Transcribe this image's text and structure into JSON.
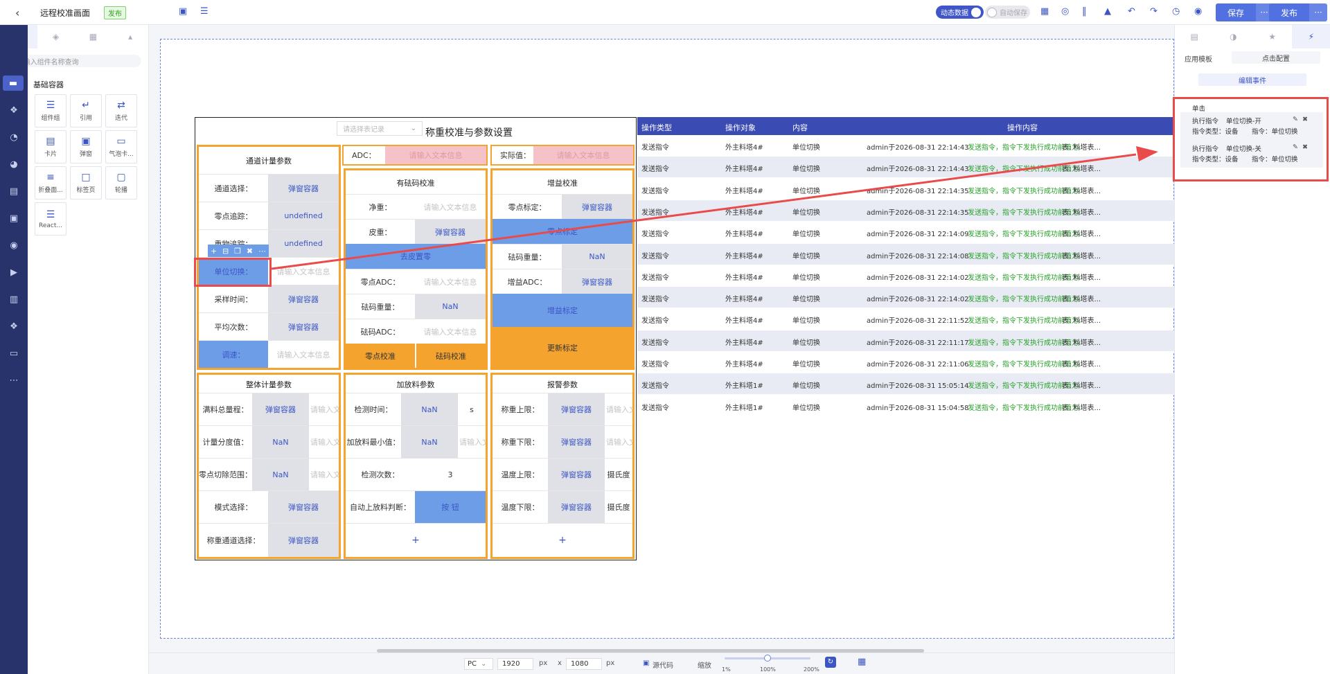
{
  "header": {
    "title": "远程校准画面",
    "tag": "发布",
    "toggle_dynamic": "动态数据",
    "toggle_autosave": "自动保存",
    "save": "保存",
    "more": "···",
    "publish": "发布"
  },
  "left_panel": {
    "search_placeholder": "请输入组件名称查询",
    "category": "基础容器",
    "components": [
      "组件组",
      "引用",
      "迭代",
      "卡片",
      "弹窗",
      "气泡卡...",
      "折叠面...",
      "标签页",
      "轮播",
      "React..."
    ]
  },
  "panel": {
    "selector_placeholder": "请选择表记录",
    "title": "称重校准与参数设置",
    "adc_label": "ADC：",
    "adc_placeholder": "请输入文本信息",
    "actual_label": "实际值：",
    "actual_placeholder": "请输入文本信息",
    "channel": {
      "heading": "通道计量参数",
      "rows": [
        {
          "label": "通道选择：",
          "value": "弹窗容器"
        },
        {
          "label": "零点追踪：",
          "value": "undefined"
        },
        {
          "label": "重物追踪：",
          "value": "undefined"
        },
        {
          "label": "单位切换：",
          "value": "请输入文本信息"
        },
        {
          "label": "采样时间：",
          "value": "弹窗容器"
        },
        {
          "label": "平均次数：",
          "value": "弹窗容器"
        },
        {
          "label": "调速：",
          "value": "请输入文本信息"
        }
      ]
    },
    "weight_cal": {
      "heading": "有砝码校准",
      "net_label": "净重：",
      "net_ph": "请输入文本信息",
      "tare_label": "皮重：",
      "tare_value": "弹窗容器",
      "tare_btn": "去皮置零",
      "zero_adc_label": "零点ADC：",
      "zero_adc_ph": "请输入文本信息",
      "weight_label": "砝码重量：",
      "weight_value": "NaN",
      "weight_adc_label": "砝码ADC：",
      "weight_adc_ph": "请输入文本信息",
      "btn_zero": "零点校准",
      "btn_weight": "砝码校准"
    },
    "gain_cal": {
      "heading": "增益校准",
      "zero_set_label": "零点标定：",
      "zero_set_value": "弹窗容器",
      "zero_btn": "零点标定",
      "weight_label": "砝码重量：",
      "weight_value": "NaN",
      "gain_adc_label": "增益ADC：",
      "gain_adc_value": "弹窗容器",
      "gain_btn": "增益标定",
      "update_btn": "更新标定"
    },
    "overall": {
      "heading": "整体计量参数",
      "rows": [
        {
          "label": "满料总量程：",
          "value": "弹窗容器",
          "ph": "请输入文本信息"
        },
        {
          "label": "计量分度值：",
          "value": "NaN",
          "ph": "请输入文本信息"
        },
        {
          "label": "零点切除范围：",
          "value": "NaN",
          "ph": "请输入文本信息"
        },
        {
          "label": "模式选择：",
          "value": "弹窗容器"
        },
        {
          "label": "称重通道选择：",
          "value": "弹窗容器"
        }
      ]
    },
    "feeding": {
      "heading": "加放料参数",
      "detect_time_label": "检测时间：",
      "detect_time_value": "NaN",
      "detect_time_unit": "s",
      "min_label": "加放料最小值：",
      "min_value": "NaN",
      "min_ph": "请输入文本信息",
      "count_label": "检测次数：",
      "count_value": "3",
      "auto_label": "自动上放料判断：",
      "auto_btn": "按 钮"
    },
    "alarm": {
      "heading": "报警参数",
      "rows": [
        {
          "label": "称重上限：",
          "value": "弹窗容器",
          "extra": "请输入文本信息"
        },
        {
          "label": "称重下限：",
          "value": "弹窗容器",
          "extra": "请输入文本信息"
        },
        {
          "label": "温度上限：",
          "value": "弹窗容器",
          "extra": "摄氏度"
        },
        {
          "label": "温度下限：",
          "value": "弹窗容器",
          "extra": "摄氏度"
        }
      ]
    }
  },
  "table": {
    "headers": [
      "操作类型",
      "操作对象",
      "内容",
      "操作内容"
    ],
    "rows": [
      {
        "type": "发送指令",
        "target": "外主料塔4#",
        "content": "单位切换",
        "prefix": "admin于2026-08-31 22:14:43",
        "msg": "发送指令，指令下发执行成功前值为:",
        "tail": "表: 料塔表..."
      },
      {
        "type": "发送指令",
        "target": "外主料塔4#",
        "content": "单位切换",
        "prefix": "admin于2026-08-31 22:14:43",
        "msg": "发送指令，指令下发执行成功前值为:",
        "tail": "表: 料塔表..."
      },
      {
        "type": "发送指令",
        "target": "外主料塔4#",
        "content": "单位切换",
        "prefix": "admin于2026-08-31 22:14:35",
        "msg": "发送指令，指令下发执行成功前值为:",
        "tail": "表: 料塔表..."
      },
      {
        "type": "发送指令",
        "target": "外主料塔4#",
        "content": "单位切换",
        "prefix": "admin于2026-08-31 22:14:35",
        "msg": "发送指令，指令下发执行成功前值为:",
        "tail": "表: 料塔表..."
      },
      {
        "type": "发送指令",
        "target": "外主料塔4#",
        "content": "单位切换",
        "prefix": "admin于2026-08-31 22:14:09",
        "msg": "发送指令，指令下发执行成功前值为:",
        "tail": "表: 料塔表..."
      },
      {
        "type": "发送指令",
        "target": "外主料塔4#",
        "content": "单位切换",
        "prefix": "admin于2026-08-31 22:14:08",
        "msg": "发送指令，指令下发执行成功前值为:",
        "tail": "表: 料塔表..."
      },
      {
        "type": "发送指令",
        "target": "外主料塔4#",
        "content": "单位切换",
        "prefix": "admin于2026-08-31 22:14:02",
        "msg": "发送指令，指令下发执行成功前值为:",
        "tail": "表: 料塔表..."
      },
      {
        "type": "发送指令",
        "target": "外主料塔4#",
        "content": "单位切换",
        "prefix": "admin于2026-08-31 22:14:02",
        "msg": "发送指令，指令下发执行成功前值为:",
        "tail": "表: 料塔表..."
      },
      {
        "type": "发送指令",
        "target": "外主料塔4#",
        "content": "单位切换",
        "prefix": "admin于2026-08-31 22:11:52",
        "msg": "发送指令，指令下发执行成功前值为:",
        "tail": "表: 料塔表..."
      },
      {
        "type": "发送指令",
        "target": "外主料塔4#",
        "content": "单位切换",
        "prefix": "admin于2026-08-31 22:11:17",
        "msg": "发送指令，指令下发执行成功前值为:",
        "tail": "表: 料塔表..."
      },
      {
        "type": "发送指令",
        "target": "外主料塔4#",
        "content": "单位切换",
        "prefix": "admin于2026-08-31 22:11:06",
        "msg": "发送指令，指令下发执行成功前值为:",
        "tail": "表: 料塔表..."
      },
      {
        "type": "发送指令",
        "target": "外主料塔1#",
        "content": "单位切换",
        "prefix": "admin于2026-08-31 15:05:14",
        "msg": "发送指令，指令下发执行成功前值为:",
        "tail": "表: 料塔表..."
      },
      {
        "type": "发送指令",
        "target": "外主料塔1#",
        "content": "单位切换",
        "prefix": "admin于2026-08-31 15:04:58",
        "msg": "发送指令，指令下发执行成功前值为:",
        "tail": "表: 料塔表..."
      }
    ]
  },
  "right_panel": {
    "app_template_label": "应用模板",
    "click_config": "点击配置",
    "edit_event": "编辑事件",
    "event_title": "单击",
    "events": [
      {
        "exec_label": "执行指令",
        "exec_value": "单位切换-开",
        "type_label": "指令类型：设备",
        "cmd_label": "指令：单位切换"
      },
      {
        "exec_label": "执行指令",
        "exec_value": "单位切换-关",
        "type_label": "指令类型：设备",
        "cmd_label": "指令：单位切换"
      }
    ]
  },
  "bottom": {
    "device": "PC",
    "width": "1920",
    "height": "1080",
    "unit": "px",
    "x": "x",
    "source": "源代码",
    "zoom_label": "缩放",
    "zoom_min": "1%",
    "zoom_mid": "100%",
    "zoom_max": "200%",
    "zoom_level": 0.5
  },
  "colors": {
    "accent": "#3b55c4",
    "orange": "#f4a42e",
    "red_annotation": "#e94a4a",
    "table_header": "#3b4bb4"
  }
}
